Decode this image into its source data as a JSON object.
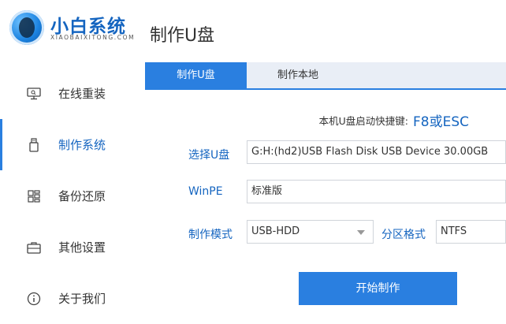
{
  "app": {
    "name": "小白系统",
    "subtitle": "XIAOBAIXITONG.COM"
  },
  "sidebar": {
    "items": [
      {
        "label": "在线重装",
        "icon": "monitor-icon",
        "active": false
      },
      {
        "label": "制作系统",
        "icon": "usb-drive-icon",
        "active": true
      },
      {
        "label": "备份还原",
        "icon": "grid-blocks-icon",
        "active": false
      },
      {
        "label": "其他设置",
        "icon": "toolbox-icon",
        "active": false
      },
      {
        "label": "关于我们",
        "icon": "info-icon",
        "active": false
      }
    ]
  },
  "page": {
    "title": "制作U盘"
  },
  "tabs": [
    {
      "label": "制作U盘",
      "active": true
    },
    {
      "label": "制作本地",
      "active": false
    }
  ],
  "shortcut": {
    "label": "本机U盘启动快捷键:",
    "key": "F8或ESC"
  },
  "form": {
    "usb_label": "选择U盘",
    "usb_value": "G:H:(hd2)USB Flash Disk USB Device 30.00GB",
    "winpe_label": "WinPE",
    "winpe_value": "标准版",
    "mode_label": "制作模式",
    "mode_value": "USB-HDD",
    "partition_label": "分区格式",
    "partition_value": "NTFS"
  },
  "actions": {
    "start_label": "开始制作"
  },
  "colors": {
    "accent": "#2a7fe0",
    "text_accent": "#1565c0",
    "tab_bar_bg": "#e9eef6"
  }
}
